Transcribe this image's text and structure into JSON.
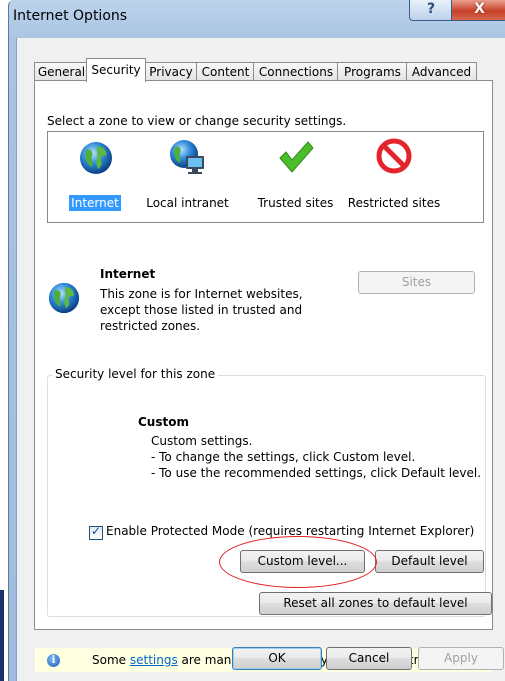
{
  "window": {
    "title": "Internet Options",
    "help_label": "?",
    "close_label": "X"
  },
  "tabs": [
    {
      "label": "General",
      "active": false
    },
    {
      "label": "Security",
      "active": true
    },
    {
      "label": "Privacy",
      "active": false
    },
    {
      "label": "Content",
      "active": false
    },
    {
      "label": "Connections",
      "active": false
    },
    {
      "label": "Programs",
      "active": false
    },
    {
      "label": "Advanced",
      "active": false
    }
  ],
  "security": {
    "zone_prompt": "Select a zone to view or change security settings.",
    "zones": [
      {
        "label": "Internet",
        "icon": "globe-icon",
        "selected": true
      },
      {
        "label": "Local intranet",
        "icon": "intranet-icon",
        "selected": false
      },
      {
        "label": "Trusted sites",
        "icon": "checkmark-icon",
        "selected": false
      },
      {
        "label": "Restricted sites",
        "icon": "no-entry-icon",
        "selected": false
      }
    ],
    "zone_title": "Internet",
    "zone_desc_1": "This zone is for Internet websites,",
    "zone_desc_2": "except those listed in trusted and",
    "zone_desc_3": "restricted zones.",
    "sites_label": "Sites",
    "level_group_label": "Security level for this zone",
    "level_title": "Custom",
    "level_line_1": "Custom settings.",
    "level_line_2": "- To change the settings, click Custom level.",
    "level_line_3": "- To use the recommended settings, click Default level.",
    "protected_mode_label": "Enable Protected Mode (requires restarting Internet Explorer)",
    "protected_mode_checked": true,
    "custom_level_label": "Custom level...",
    "default_level_label": "Default level",
    "reset_label": "Reset all zones to default level",
    "info_prefix": "Some ",
    "info_link": "settings",
    "info_suffix": " are managed by your system administrator."
  },
  "footer": {
    "ok_label": "OK",
    "cancel_label": "Cancel",
    "apply_label": "Apply"
  },
  "colors": {
    "accent": "#3399ff",
    "annotation": "#e02020",
    "info_bar": "#ffffe1"
  }
}
